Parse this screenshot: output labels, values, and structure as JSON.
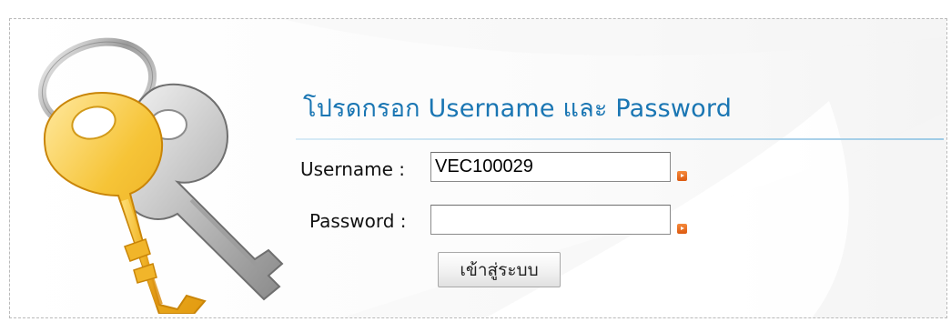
{
  "login_form": {
    "heading": "โปรดกรอก Username และ Password",
    "username_label": "Username :",
    "username_value": "VEC100029",
    "password_label": "Password :",
    "password_value": "",
    "submit_label": "เข้าสู่ระบบ",
    "required_icon": "orange-arrow-bullet-icon",
    "illustration_icon": "keys-icon"
  },
  "colors": {
    "heading": "#1a76b3",
    "divider": "#9fcbe6",
    "required_marker": "#e8671f",
    "panel_border": "#b9b9b9"
  }
}
